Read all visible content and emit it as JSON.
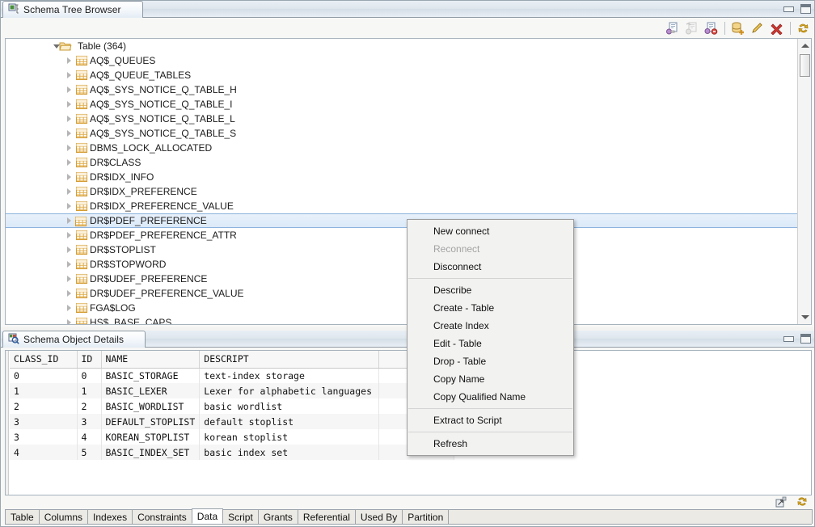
{
  "window": {
    "minimize_label": "Minimize",
    "maximize_label": "Maximize"
  },
  "tree_panel": {
    "tab_title": "Schema Tree Browser",
    "tab_icon": "schema-tree-icon",
    "toolbar": [
      {
        "name": "new-connection-icon",
        "label": "New connect",
        "enabled": true
      },
      {
        "name": "reconnect-icon",
        "label": "Reconnect",
        "enabled": false
      },
      {
        "name": "disconnect-icon",
        "label": "Disconnect",
        "enabled": true
      },
      {
        "name": "create-table-icon",
        "label": "Create - Table",
        "enabled": true
      },
      {
        "name": "edit-table-icon",
        "label": "Edit - Table",
        "enabled": true
      },
      {
        "name": "drop-table-icon",
        "label": "Drop - Table",
        "enabled": true
      },
      {
        "name": "refresh-icon",
        "label": "Refresh",
        "enabled": true
      }
    ],
    "root": {
      "label": "Table (364)",
      "expanded": true,
      "icon": "open-folder-icon"
    },
    "items": [
      {
        "label": "AQ$_QUEUES",
        "selected": false
      },
      {
        "label": "AQ$_QUEUE_TABLES",
        "selected": false
      },
      {
        "label": "AQ$_SYS_NOTICE_Q_TABLE_H",
        "selected": false
      },
      {
        "label": "AQ$_SYS_NOTICE_Q_TABLE_I",
        "selected": false
      },
      {
        "label": "AQ$_SYS_NOTICE_Q_TABLE_L",
        "selected": false
      },
      {
        "label": "AQ$_SYS_NOTICE_Q_TABLE_S",
        "selected": false
      },
      {
        "label": "DBMS_LOCK_ALLOCATED",
        "selected": false
      },
      {
        "label": "DR$CLASS",
        "selected": false
      },
      {
        "label": "DR$IDX_INFO",
        "selected": false
      },
      {
        "label": "DR$IDX_PREFERENCE",
        "selected": false
      },
      {
        "label": "DR$IDX_PREFERENCE_VALUE",
        "selected": false
      },
      {
        "label": "DR$PDEF_PREFERENCE",
        "selected": true
      },
      {
        "label": "DR$PDEF_PREFERENCE_ATTR",
        "selected": false
      },
      {
        "label": "DR$STOPLIST",
        "selected": false
      },
      {
        "label": "DR$STOPWORD",
        "selected": false
      },
      {
        "label": "DR$UDEF_PREFERENCE",
        "selected": false
      },
      {
        "label": "DR$UDEF_PREFERENCE_VALUE",
        "selected": false
      },
      {
        "label": "FGA$LOG",
        "selected": false
      },
      {
        "label": "HS$_BASE_CAPS",
        "selected": false
      }
    ]
  },
  "context_menu": {
    "groups": [
      [
        {
          "label": "New connect",
          "enabled": true
        },
        {
          "label": "Reconnect",
          "enabled": false
        },
        {
          "label": "Disconnect",
          "enabled": true
        }
      ],
      [
        {
          "label": "Describe",
          "enabled": true
        },
        {
          "label": "Create - Table",
          "enabled": true
        },
        {
          "label": "Create Index",
          "enabled": true
        },
        {
          "label": "Edit - Table",
          "enabled": true
        },
        {
          "label": "Drop - Table",
          "enabled": true
        },
        {
          "label": "Copy Name",
          "enabled": true
        },
        {
          "label": "Copy Qualified Name",
          "enabled": true
        }
      ],
      [
        {
          "label": "Extract to Script",
          "enabled": true
        }
      ],
      [
        {
          "label": "Refresh",
          "enabled": true
        }
      ]
    ]
  },
  "details_panel": {
    "tab_title": "Schema Object Details",
    "tab_icon": "schema-object-details-icon",
    "columns": [
      "CLASS_ID",
      "ID",
      "NAME",
      "DESCRIPT",
      ""
    ],
    "rows": [
      [
        "0",
        "0",
        "BASIC_STORAGE",
        "text-index storage",
        ""
      ],
      [
        "1",
        "1",
        "BASIC_LEXER",
        "Lexer for alphabetic languages",
        ""
      ],
      [
        "2",
        "2",
        "BASIC_WORDLIST",
        "basic wordlist",
        ""
      ],
      [
        "3",
        "3",
        "DEFAULT_STOPLIST",
        "default stoplist",
        ""
      ],
      [
        "3",
        "4",
        "KOREAN_STOPLIST",
        "korean stoplist",
        ""
      ],
      [
        "4",
        "5",
        "BASIC_INDEX_SET",
        "basic index set",
        ""
      ]
    ],
    "foot_icons": [
      {
        "name": "maximize-results-icon",
        "label": "Maximize"
      },
      {
        "name": "refresh-icon",
        "label": "Refresh"
      }
    ],
    "tabs": [
      {
        "label": "Table",
        "active": false
      },
      {
        "label": "Columns",
        "active": false
      },
      {
        "label": "Indexes",
        "active": false
      },
      {
        "label": "Constraints",
        "active": false
      },
      {
        "label": "Data",
        "active": true
      },
      {
        "label": "Script",
        "active": false
      },
      {
        "label": "Grants",
        "active": false
      },
      {
        "label": "Referential",
        "active": false
      },
      {
        "label": "Used By",
        "active": false
      },
      {
        "label": "Partition",
        "active": false
      }
    ]
  },
  "colors": {
    "selection_blue": "#dbe9f8",
    "selection_border": "#8cb2dd",
    "table_icon_orange": "#e8a33d",
    "folder_orange": "#e3a23c",
    "delete_red": "#cf3a33",
    "refresh_gold": "#e8b12c"
  }
}
